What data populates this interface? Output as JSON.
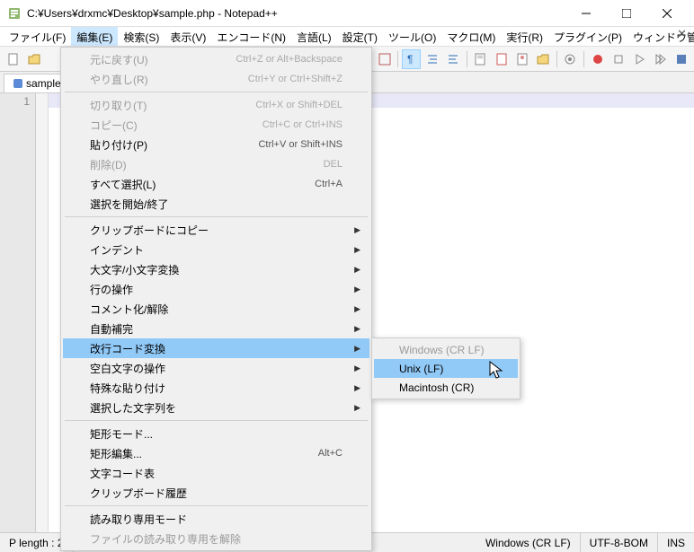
{
  "title": "C:¥Users¥drxmc¥Desktop¥sample.php - Notepad++",
  "menubar": {
    "file": "ファイル(F)",
    "edit": "編集(E)",
    "search": "検索(S)",
    "view": "表示(V)",
    "encoding": "エンコード(N)",
    "language": "言語(L)",
    "settings": "設定(T)",
    "tools": "ツール(O)",
    "macro": "マクロ(M)",
    "run": "実行(R)",
    "plugins": "プラグイン(P)",
    "window": "ウィンドウ管理(W)",
    "help": "?"
  },
  "tab": {
    "name": "sample"
  },
  "gutter": {
    "line1": "1"
  },
  "edit_menu": {
    "undo": "元に戻す(U)",
    "undo_sc": "Ctrl+Z or Alt+Backspace",
    "redo": "やり直し(R)",
    "redo_sc": "Ctrl+Y or Ctrl+Shift+Z",
    "cut": "切り取り(T)",
    "cut_sc": "Ctrl+X or Shift+DEL",
    "copy": "コピー(C)",
    "copy_sc": "Ctrl+C or Ctrl+INS",
    "paste": "貼り付け(P)",
    "paste_sc": "Ctrl+V or Shift+INS",
    "delete": "削除(D)",
    "delete_sc": "DEL",
    "selectall": "すべて選択(L)",
    "selectall_sc": "Ctrl+A",
    "beginend": "選択を開始/終了",
    "clipboard": "クリップボードにコピー",
    "indent": "インデント",
    "case": "大文字/小文字変換",
    "lineops": "行の操作",
    "comment": "コメント化/解除",
    "autocomplete": "自動補完",
    "eol": "改行コード変換",
    "blank": "空白文字の操作",
    "pastespecial": "特殊な貼り付け",
    "selection": "選択した文字列を",
    "columnmode": "矩形モード...",
    "columnedit": "矩形編集...",
    "columnedit_sc": "Alt+C",
    "charpanel": "文字コード表",
    "cliphistory": "クリップボード履歴",
    "readonly": "読み取り専用モード",
    "clearreadonly": "ファイルの読み取り専用を解除"
  },
  "eol_sub": {
    "windows": "Windows (CR LF)",
    "unix": "Unix (LF)",
    "mac": "Macintosh (CR)"
  },
  "status": {
    "length": "P  length : 2",
    "eol": "Windows (CR LF)",
    "enc": "UTF-8-BOM",
    "ins": "INS"
  }
}
